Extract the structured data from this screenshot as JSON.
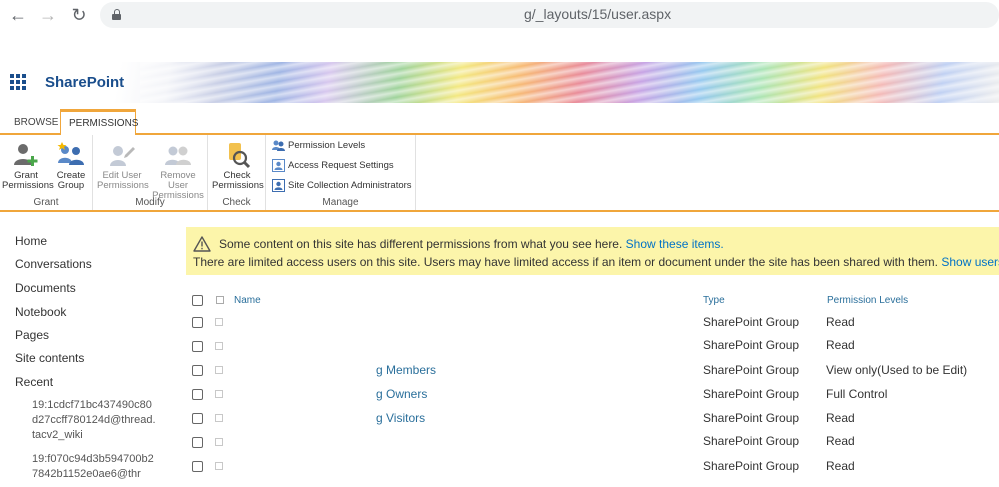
{
  "browser": {
    "url": "g/_layouts/15/user.aspx"
  },
  "suite": {
    "brand": "SharePoint"
  },
  "ribbon": {
    "tabs": [
      {
        "label": "BROWSE"
      },
      {
        "label": "PERMISSIONS"
      }
    ],
    "groups": {
      "grant": {
        "label": "Grant",
        "buttons": [
          {
            "line1": "Grant",
            "line2": "Permissions"
          },
          {
            "line1": "Create",
            "line2": "Group"
          }
        ]
      },
      "modify": {
        "label": "Modify",
        "buttons": [
          {
            "line1": "Edit User",
            "line2": "Permissions"
          },
          {
            "line1": "Remove User",
            "line2": "Permissions"
          }
        ]
      },
      "check": {
        "label": "Check",
        "buttons": [
          {
            "line1": "Check",
            "line2": "Permissions"
          }
        ]
      },
      "manage": {
        "label": "Manage",
        "items": [
          {
            "label": "Permission Levels"
          },
          {
            "label": "Access Request Settings"
          },
          {
            "label": "Site Collection Administrators"
          }
        ]
      }
    }
  },
  "leftnav": {
    "items": [
      {
        "label": "Home"
      },
      {
        "label": "Conversations"
      },
      {
        "label": "Documents"
      },
      {
        "label": "Notebook"
      },
      {
        "label": "Pages"
      },
      {
        "label": "Site contents"
      },
      {
        "label": "Recent"
      }
    ],
    "recent": [
      {
        "label": "19:1cdcf71bc437490c80d27ccff780124d@thread.tacv2_wiki"
      },
      {
        "label": "19:f070c94d3b594700b27842b1152e0ae6@thr"
      }
    ]
  },
  "notice": {
    "line1": "Some content on this site has different permissions from what you see here.",
    "line1_link": "Show these items.",
    "line2": "There are limited access users on this site. Users may have limited access if an item or document under the site has been shared with them.",
    "line2_link": "Show users."
  },
  "table": {
    "headers": {
      "name": "Name",
      "type": "Type",
      "permission": "Permission Levels"
    },
    "rows": [
      {
        "name": "",
        "type": "SharePoint Group",
        "permission": "Read"
      },
      {
        "name": "",
        "type": "SharePoint Group",
        "permission": "Read"
      },
      {
        "name": "g Members",
        "type": "SharePoint Group",
        "permission": "View only(Used to be Edit)"
      },
      {
        "name": "g Owners",
        "type": "SharePoint Group",
        "permission": "Full Control"
      },
      {
        "name": "g Visitors",
        "type": "SharePoint Group",
        "permission": "Read"
      },
      {
        "name": "",
        "type": "SharePoint Group",
        "permission": "Read"
      },
      {
        "name": "",
        "type": "SharePoint Group",
        "permission": "Read"
      }
    ]
  },
  "colors": {
    "ribbon_accent": "#f0a63b",
    "link": "#0072c6",
    "notice_bg": "#fcf5aa"
  }
}
